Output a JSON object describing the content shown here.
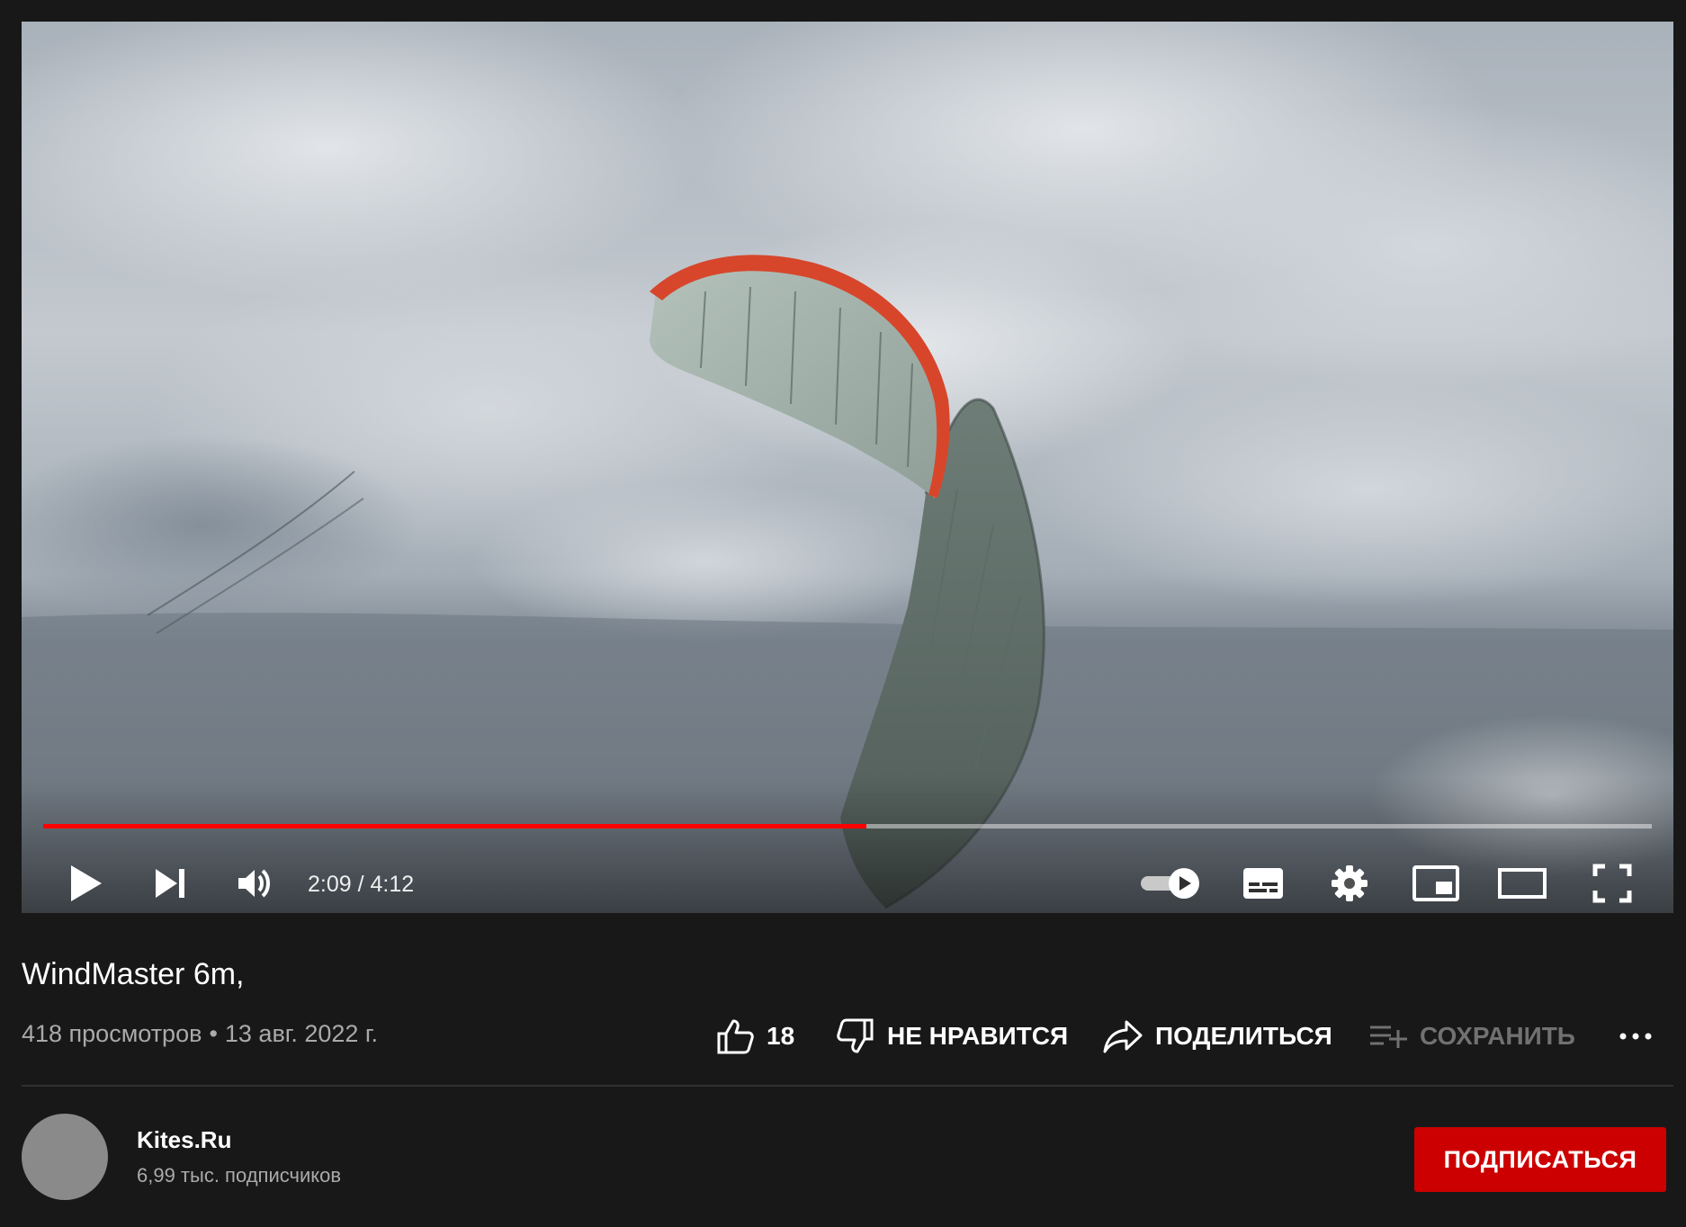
{
  "player": {
    "time_current": "2:09",
    "time_total": "4:12",
    "time_display": "2:09 / 4:12",
    "progress_fraction": 0.512,
    "autoplay_enabled": true,
    "accent_color": "#ff0000"
  },
  "video": {
    "title": "WindMaster 6m,",
    "views": "418 просмотров",
    "separator": "•",
    "date": "13 авг. 2022 г."
  },
  "actions": {
    "likes": "18",
    "dislike_label": "НЕ НРАВИТСЯ",
    "share_label": "ПОДЕЛИТЬСЯ",
    "save_label": "СОХРАНИТЬ"
  },
  "channel": {
    "name": "Kites.Ru",
    "subscribers": "6,99 тыс. подписчиков",
    "subscribe_label": "ПОДПИСАТЬСЯ",
    "subscribe_color": "#cc0000"
  },
  "icons": {
    "controls": [
      "play-icon",
      "next-icon",
      "volume-icon",
      "autoplay-toggle-icon",
      "subtitles-icon",
      "settings-icon",
      "miniplayer-icon",
      "theater-mode-icon",
      "fullscreen-icon"
    ],
    "actions": [
      "thumbs-up-icon",
      "thumbs-down-icon",
      "share-icon",
      "save-playlist-icon",
      "more-icon"
    ]
  }
}
